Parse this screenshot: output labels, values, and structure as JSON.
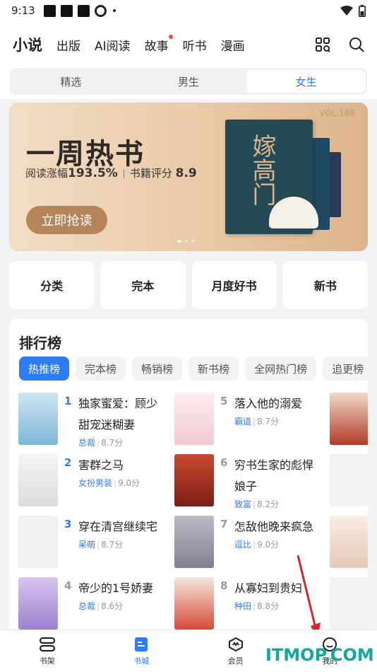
{
  "status_bar": {
    "time": "9:13"
  },
  "top_nav": {
    "tabs": [
      {
        "label": "小说",
        "active": true
      },
      {
        "label": "出版"
      },
      {
        "label": "AI阅读"
      },
      {
        "label": "故事",
        "dot": true
      },
      {
        "label": "听书"
      },
      {
        "label": "漫画"
      }
    ]
  },
  "segments": [
    {
      "label": "精选"
    },
    {
      "label": "男生"
    },
    {
      "label": "女生",
      "active": true
    }
  ],
  "banner": {
    "title": "一周热书",
    "sub_prefix": "阅读涨幅",
    "sub_value": "193.5%",
    "sub_rating_label": "书籍评分",
    "sub_rating_value": "8.9",
    "cta": "立即抢读",
    "vol": "VOL.188",
    "cover_title": "嫁高门"
  },
  "quick_links": [
    "分类",
    "完本",
    "月度好书",
    "新书"
  ],
  "ranking": {
    "title": "排行榜",
    "chips": [
      "热推榜",
      "完本榜",
      "畅销榜",
      "新书榜",
      "全网热门榜",
      "追更榜"
    ],
    "books": [
      {
        "rank": "1",
        "title": "独家蜜爱：顾少甜宠迷糊妻",
        "category": "总裁",
        "score": "8.7分"
      },
      {
        "rank": "2",
        "title": "害群之马",
        "category": "女扮男装",
        "score": "9.0分"
      },
      {
        "rank": "3",
        "title": "穿在清宫继续宅",
        "category": "呆萌",
        "score": "8.7分"
      },
      {
        "rank": "4",
        "title": "帝少的1号娇妻",
        "category": "总裁",
        "score": "8.6分"
      },
      {
        "rank": "5",
        "title": "落入他的溺爱",
        "category": "霸道",
        "score": "8.7分"
      },
      {
        "rank": "6",
        "title": "穷书生家的彪悍娘子",
        "category": "致富",
        "score": "8.2分"
      },
      {
        "rank": "7",
        "title": "怎敌他晚来疯急",
        "category": "逗比",
        "score": "9.0分"
      },
      {
        "rank": "8",
        "title": "从寡妇到贵妇",
        "category": "种田",
        "score": "8.8分"
      }
    ]
  },
  "bottom_nav": [
    {
      "label": "书架"
    },
    {
      "label": "书城",
      "active": true
    },
    {
      "label": "会员"
    },
    {
      "label": "我的"
    }
  ],
  "watermark": "ITMOP.COM",
  "colors": {
    "accent": "#2d7cf6",
    "rank_top": "#2d7cf6",
    "rank_other": "#999999",
    "banner_cta": "#b5855a"
  }
}
